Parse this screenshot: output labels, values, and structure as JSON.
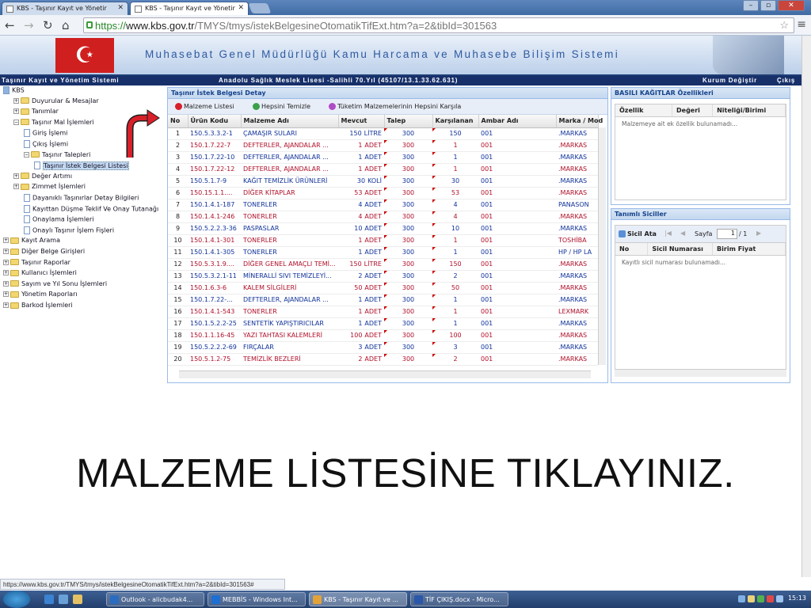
{
  "browser": {
    "tabs": [
      {
        "label": "KBS - Taşınır Kayıt ve Yönetir"
      },
      {
        "label": "KBS - Taşınır Kayıt ve Yönetir"
      }
    ],
    "url_scheme": "https://",
    "url_host": "www.kbs.gov.tr",
    "url_path": "/TMYS/tmys/istekBelgesineOtomatikTifExt.htm?a=2&tibId=301563",
    "status_url": "https://www.kbs.gov.tr/TMYS/tmys/istekBelgesineOtomatikTifExt.htm?a=2&tibId=301563#"
  },
  "header": {
    "title": "Muhasebat Genel Müdürlüğü Kamu Harcama ve Muhasebe Bilişim Sistemi",
    "flag_glyph": "☪",
    "system_name": "Taşınır Kayıt ve Yönetim Sistemi",
    "school": "Anadolu Sağlık Meslek Lisesi -Salihli 70.Yıl (45107/13.1.33.62.631)",
    "change_org": "Kurum Değiştir",
    "logout": "Çıkış"
  },
  "tree": [
    {
      "label": "KBS",
      "type": "root"
    },
    {
      "label": "Duyurular & Mesajlar",
      "type": "folder",
      "pm": "+"
    },
    {
      "label": "Tanımlar",
      "type": "folder",
      "pm": "+"
    },
    {
      "label": "Taşınır Mal İşlemleri",
      "type": "folder",
      "pm": "−"
    },
    {
      "label": "Giriş İşlemi",
      "type": "doc"
    },
    {
      "label": "Çıkış İşlemi",
      "type": "doc"
    },
    {
      "label": "Taşınır Talepleri",
      "type": "folder",
      "pm": "−"
    },
    {
      "label": "Taşınır İstek Belgesi Listesi",
      "type": "doc",
      "selected": true
    },
    {
      "label": "Değer Artımı",
      "type": "folder",
      "pm": "+"
    },
    {
      "label": "Zimmet İşlemleri",
      "type": "folder",
      "pm": "+"
    },
    {
      "label": "Dayanıklı Taşınırlar Detay Bilgileri",
      "type": "doc"
    },
    {
      "label": "Kayıttan Düşme Teklif Ve Onay Tutanağı",
      "type": "doc"
    },
    {
      "label": "Onaylama İşlemleri",
      "type": "doc"
    },
    {
      "label": "Onaylı Taşınır İşlem Fişleri",
      "type": "doc"
    },
    {
      "label": "Kayıt Arama",
      "type": "folder",
      "pm": "+"
    },
    {
      "label": "Diğer Belge Girişleri",
      "type": "folder",
      "pm": "+"
    },
    {
      "label": "Taşınır Raporlar",
      "type": "folder",
      "pm": "+"
    },
    {
      "label": "Kullanıcı İşlemleri",
      "type": "folder",
      "pm": "+"
    },
    {
      "label": "Sayım ve Yıl Sonu İşlemleri",
      "type": "folder",
      "pm": "+"
    },
    {
      "label": "Yönetim Raporları",
      "type": "folder",
      "pm": "+"
    },
    {
      "label": "Barkod İşlemleri",
      "type": "folder",
      "pm": "+"
    }
  ],
  "main": {
    "title": "Taşınır İstek Belgesi Detay",
    "toolbar": {
      "material_list": "Malzeme Listesi",
      "clear_all": "Hepsini Temizle",
      "fill_all": "Tüketim Malzemelerinin Hepsini Karşıla"
    },
    "columns": [
      "No",
      "Ürün Kodu",
      "Malzeme Adı",
      "Mevcut",
      "Talep",
      "Karşılanan",
      "Ambar Adı",
      "Marka / Mod"
    ],
    "rows": [
      {
        "no": "1",
        "code": "150.5.3.3.2-1",
        "name": "ÇAMAŞIR SULARI",
        "stock": "150",
        "unit": "LİTRE",
        "req": "300",
        "given": "150",
        "store": "001",
        "brand": ".MARKAS",
        "color": "b"
      },
      {
        "no": "2",
        "code": "150.1.7.22-7",
        "name": "DEFTERLER, AJANDALAR ...",
        "stock": "1",
        "unit": "ADET",
        "req": "300",
        "given": "1",
        "store": "001",
        "brand": ".MARKAS",
        "color": "r"
      },
      {
        "no": "3",
        "code": "150.1.7.22-10",
        "name": "DEFTERLER, AJANDALAR ...",
        "stock": "1",
        "unit": "ADET",
        "req": "300",
        "given": "1",
        "store": "001",
        "brand": ".MARKAS",
        "color": "b"
      },
      {
        "no": "4",
        "code": "150.1.7.22-12",
        "name": "DEFTERLER, AJANDALAR ...",
        "stock": "1",
        "unit": "ADET",
        "req": "300",
        "given": "1",
        "store": "001",
        "brand": ".MARKAS",
        "color": "r"
      },
      {
        "no": "5",
        "code": "150.5.1.7-9",
        "name": "KAĞIT TEMİZLİK ÜRÜNLERİ",
        "stock": "30",
        "unit": "KOLİ",
        "req": "300",
        "given": "30",
        "store": "001",
        "brand": ".MARKAS",
        "color": "b"
      },
      {
        "no": "6",
        "code": "150.15.1.1....",
        "name": "DİĞER KİTAPLAR",
        "stock": "53",
        "unit": "ADET",
        "req": "300",
        "given": "53",
        "store": "001",
        "brand": ".MARKAS",
        "color": "r"
      },
      {
        "no": "7",
        "code": "150.1.4.1-187",
        "name": "TONERLER",
        "stock": "4",
        "unit": "ADET",
        "req": "300",
        "given": "4",
        "store": "001",
        "brand": "PANASON",
        "color": "b"
      },
      {
        "no": "8",
        "code": "150.1.4.1-246",
        "name": "TONERLER",
        "stock": "4",
        "unit": "ADET",
        "req": "300",
        "given": "4",
        "store": "001",
        "brand": ".MARKAS",
        "color": "r"
      },
      {
        "no": "9",
        "code": "150.5.2.2.3-36",
        "name": "PASPASLAR",
        "stock": "10",
        "unit": "ADET",
        "req": "300",
        "given": "10",
        "store": "001",
        "brand": ".MARKAS",
        "color": "b"
      },
      {
        "no": "10",
        "code": "150.1.4.1-301",
        "name": "TONERLER",
        "stock": "1",
        "unit": "ADET",
        "req": "300",
        "given": "1",
        "store": "001",
        "brand": "TOSHİBA",
        "color": "r"
      },
      {
        "no": "11",
        "code": "150.1.4.1-305",
        "name": "TONERLER",
        "stock": "1",
        "unit": "ADET",
        "req": "300",
        "given": "1",
        "store": "001",
        "brand": "HP / HP LA",
        "color": "b"
      },
      {
        "no": "12",
        "code": "150.5.3.1.9....",
        "name": "DİĞER GENEL AMAÇLI TEMİ...",
        "stock": "150",
        "unit": "LİTRE",
        "req": "300",
        "given": "150",
        "store": "001",
        "brand": ".MARKAS",
        "color": "r"
      },
      {
        "no": "13",
        "code": "150.5.3.2.1-11",
        "name": "MİNERALLİ SIVI TEMİZLEYİ...",
        "stock": "2",
        "unit": "ADET",
        "req": "300",
        "given": "2",
        "store": "001",
        "brand": ".MARKAS",
        "color": "b"
      },
      {
        "no": "14",
        "code": "150.1.6.3-6",
        "name": "KALEM SİLGİLERİ",
        "stock": "50",
        "unit": "ADET",
        "req": "300",
        "given": "50",
        "store": "001",
        "brand": ".MARKAS",
        "color": "r"
      },
      {
        "no": "15",
        "code": "150.1.7.22-...",
        "name": "DEFTERLER, AJANDALAR ...",
        "stock": "1",
        "unit": "ADET",
        "req": "300",
        "given": "1",
        "store": "001",
        "brand": ".MARKAS",
        "color": "b"
      },
      {
        "no": "16",
        "code": "150.1.4.1-543",
        "name": "TONERLER",
        "stock": "1",
        "unit": "ADET",
        "req": "300",
        "given": "1",
        "store": "001",
        "brand": "LEXMARK",
        "color": "r"
      },
      {
        "no": "17",
        "code": "150.1.5.2.2-25",
        "name": "SENTETİK YAPIŞTIRICILAR",
        "stock": "1",
        "unit": "ADET",
        "req": "300",
        "given": "1",
        "store": "001",
        "brand": ".MARKAS",
        "color": "b"
      },
      {
        "no": "18",
        "code": "150.1.1.16-45",
        "name": "YAZI TAHTASI KALEMLERİ",
        "stock": "100",
        "unit": "ADET",
        "req": "300",
        "given": "100",
        "store": "001",
        "brand": ".MARKAS",
        "color": "r"
      },
      {
        "no": "19",
        "code": "150.5.2.2.2-69",
        "name": "FIRÇALAR",
        "stock": "3",
        "unit": "ADET",
        "req": "300",
        "given": "3",
        "store": "001",
        "brand": ".MARKAS",
        "color": "b"
      },
      {
        "no": "20",
        "code": "150.5.1.2-75",
        "name": "TEMİZLİK BEZLERİ",
        "stock": "2",
        "unit": "ADET",
        "req": "300",
        "given": "2",
        "store": "001",
        "brand": ".MARKAS",
        "color": "r"
      }
    ]
  },
  "printed_forms": {
    "title": "BASILI KAĞITLAR Özellikleri",
    "columns": [
      "Özellik",
      "Değeri",
      "Niteliği/Birimi"
    ],
    "empty": "Malzemeye ait ek özellik bulunamadı..."
  },
  "registries": {
    "title": "Tanımlı Siciller",
    "assign_button": "Sicil Ata",
    "page_label": "Sayfa",
    "page_value": "1",
    "page_total": "/ 1",
    "columns": [
      "No",
      "Sicil Numarası",
      "Birim Fiyat"
    ],
    "empty": "Kayıtlı sicil numarası bulunamadı..."
  },
  "instruction": "MALZEME LİSTESİNE TIKLAYINIZ.",
  "taskbar": {
    "items": [
      {
        "label": "Outlook - alicbudak4...",
        "color": "#2b6cc0"
      },
      {
        "label": "MEBBİS - Windows Int...",
        "color": "#1f6fd0"
      },
      {
        "label": "KBS - Taşınır Kayıt ve ...",
        "color": "#e2a23a"
      },
      {
        "label": "TİF ÇIKIŞ.docx - Micro...",
        "color": "#2b57a8"
      }
    ],
    "time": "15:13"
  },
  "colors": {
    "accent": "#15428b",
    "row_red": "#b0102a",
    "row_blue": "#10329a",
    "banner_dark": "#17306a"
  }
}
